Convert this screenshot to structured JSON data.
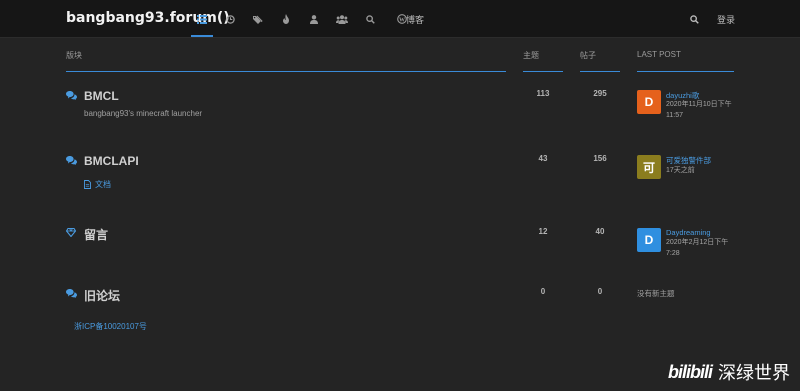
{
  "navbar": {
    "brand": "bangbang93.forum()",
    "nav_items": [
      {
        "icon": "list-icon"
      },
      {
        "icon": "clock-icon"
      },
      {
        "icon": "tags-icon"
      },
      {
        "icon": "fire-icon"
      },
      {
        "icon": "user-icon"
      },
      {
        "icon": "users-icon"
      },
      {
        "icon": "search-icon"
      }
    ],
    "blog_label": "博客",
    "login_label": "登录"
  },
  "table": {
    "col_category": "版块",
    "col_topics": "主题",
    "col_posts": "帖子",
    "col_last_post": "LAST POST"
  },
  "rows": [
    {
      "title": "BMCL",
      "description": "bangbang93's minecraft launcher",
      "topics": "113",
      "posts": "295",
      "last_post": {
        "avatar_letter": "D",
        "avatar_color": "#e5611c",
        "user": "dayuzhi歌",
        "time": "2020年11月10日下午 11:57"
      }
    },
    {
      "title": "BMCLAPI",
      "sub_link": "文档",
      "topics": "43",
      "posts": "156",
      "last_post": {
        "avatar_letter": "可",
        "avatar_color": "#8b7d1e",
        "user": "可爱独警件部",
        "time": "17天之前"
      }
    },
    {
      "title": "留言",
      "topics": "12",
      "posts": "40",
      "last_post": {
        "avatar_letter": "D",
        "avatar_color": "#2f8fe0",
        "user": "Daydreaming",
        "time": "2020年2月12日下午 7:28"
      }
    },
    {
      "title": "旧论坛",
      "topics": "0",
      "posts": "0",
      "last_post_none": "没有新主题"
    }
  ],
  "footer": {
    "icp": "浙ICP备10020107号"
  },
  "watermark": {
    "logo": "bilibili",
    "text": "深绿世界"
  }
}
